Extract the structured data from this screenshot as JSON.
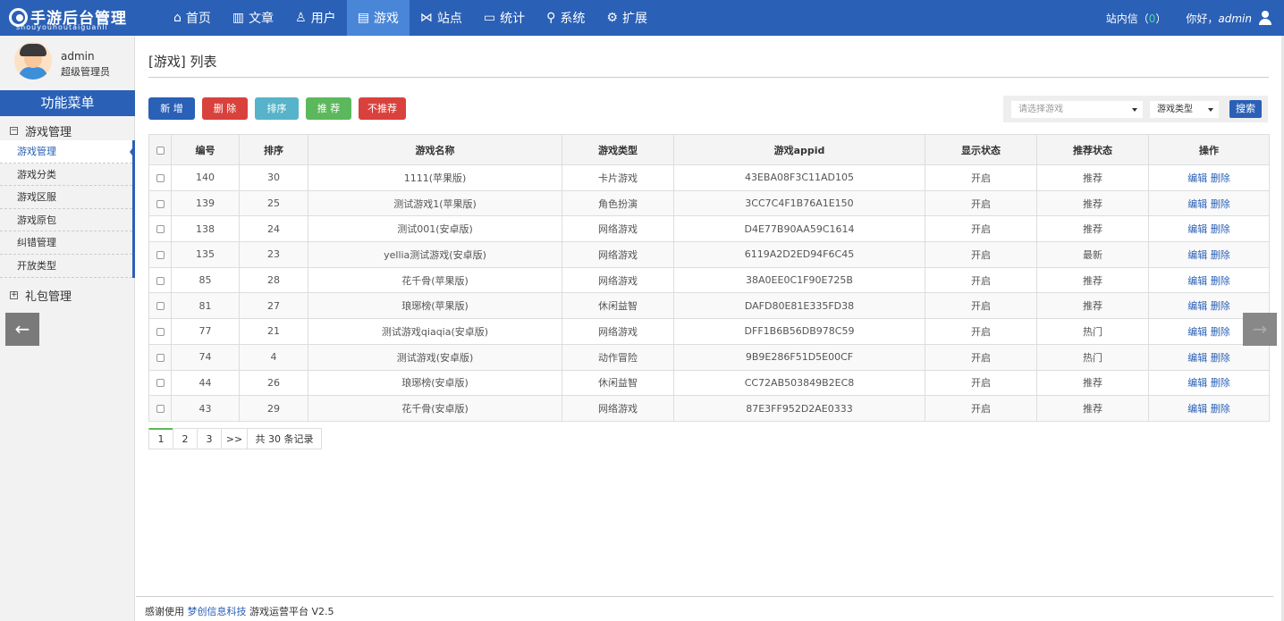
{
  "app": {
    "logo_title": "手游后台管理",
    "logo_sub": "shouyouhoutaiguanli"
  },
  "nav": [
    {
      "label": "首页",
      "icon": "home-icon",
      "glyph": "⌂"
    },
    {
      "label": "文章",
      "icon": "bar-chart-icon",
      "glyph": "▥"
    },
    {
      "label": "用户",
      "icon": "user-icon",
      "glyph": "♙"
    },
    {
      "label": "游戏",
      "icon": "document-icon",
      "glyph": "▤"
    },
    {
      "label": "站点",
      "icon": "share-icon",
      "glyph": "⋈"
    },
    {
      "label": "统计",
      "icon": "monitor-icon",
      "glyph": "▭"
    },
    {
      "label": "系统",
      "icon": "wrench-icon",
      "glyph": "⚲"
    },
    {
      "label": "扩展",
      "icon": "gear-icon",
      "glyph": "⚙"
    }
  ],
  "top_right": {
    "msg_label": "站内信",
    "msg_open": "（",
    "msg_count": "0",
    "msg_close": "）",
    "hello": "你好，",
    "username": "admin"
  },
  "sidebar": {
    "name": "admin",
    "role": "超级管理员",
    "menu_title": "功能菜单",
    "groups": [
      {
        "label": "游戏管理",
        "toggle": "−",
        "items": [
          "游戏管理",
          "游戏分类",
          "游戏区服",
          "游戏原包",
          "纠错管理",
          "开放类型"
        ]
      },
      {
        "label": "礼包管理",
        "toggle": "+",
        "items": []
      }
    ],
    "back_glyph": "←"
  },
  "page": {
    "title": "[游戏] 列表"
  },
  "toolbar": {
    "add": "新 增",
    "delete": "删 除",
    "sort": "排序",
    "recommend": "推 荐",
    "unrecommend": "不推荐",
    "select_game_placeholder": "请选择游戏",
    "select_type": "游戏类型",
    "search": "搜索"
  },
  "colors": {
    "primary": "#2a60b6",
    "danger": "#d9413d",
    "info": "#56b3c9",
    "success": "#5cb85c",
    "danger2": "#d9413d"
  },
  "table": {
    "headers": [
      "编号",
      "排序",
      "游戏名称",
      "游戏类型",
      "游戏appid",
      "显示状态",
      "推荐状态",
      "操作"
    ],
    "rows": [
      {
        "id": "140",
        "sort": "30",
        "name": "1111(苹果版)",
        "type": "卡片游戏",
        "appid": "43EBA08F3C11AD105",
        "show": "开启",
        "rec": "推荐"
      },
      {
        "id": "139",
        "sort": "25",
        "name": "测试游戏1(苹果版)",
        "type": "角色扮演",
        "appid": "3CC7C4F1B76A1E150",
        "show": "开启",
        "rec": "推荐"
      },
      {
        "id": "138",
        "sort": "24",
        "name": "测试001(安卓版)",
        "type": "网络游戏",
        "appid": "D4E77B90AA59C1614",
        "show": "开启",
        "rec": "推荐"
      },
      {
        "id": "135",
        "sort": "23",
        "name": "yellia测试游戏(安卓版)",
        "type": "网络游戏",
        "appid": "6119A2D2ED94F6C45",
        "show": "开启",
        "rec": "最新"
      },
      {
        "id": "85",
        "sort": "28",
        "name": "花千骨(苹果版)",
        "type": "网络游戏",
        "appid": "38A0EE0C1F90E725B",
        "show": "开启",
        "rec": "推荐"
      },
      {
        "id": "81",
        "sort": "27",
        "name": "琅琊榜(苹果版)",
        "type": "休闲益智",
        "appid": "DAFD80E81E335FD38",
        "show": "开启",
        "rec": "推荐"
      },
      {
        "id": "77",
        "sort": "21",
        "name": "测试游戏qiaqia(安卓版)",
        "type": "网络游戏",
        "appid": "DFF1B6B56DB978C59",
        "show": "开启",
        "rec": "热门"
      },
      {
        "id": "74",
        "sort": "4",
        "name": "测试游戏(安卓版)",
        "type": "动作冒险",
        "appid": "9B9E286F51D5E00CF",
        "show": "开启",
        "rec": "热门"
      },
      {
        "id": "44",
        "sort": "26",
        "name": "琅琊榜(安卓版)",
        "type": "休闲益智",
        "appid": "CC72AB503849B2EC8",
        "show": "开启",
        "rec": "推荐"
      },
      {
        "id": "43",
        "sort": "29",
        "name": "花千骨(安卓版)",
        "type": "网络游戏",
        "appid": "87E3FF952D2AE0333",
        "show": "开启",
        "rec": "推荐"
      }
    ],
    "edit_label": "编辑",
    "delete_label": "删除"
  },
  "pagination": {
    "pages": [
      "1",
      "2",
      "3"
    ],
    "next": ">>",
    "total": "共 30 条记录",
    "current": "1"
  },
  "footer": {
    "prefix": "感谢使用",
    "company": "梦创信息科技",
    "suffix": "游戏运营平台 V2.5"
  },
  "forward_glyph": "→"
}
